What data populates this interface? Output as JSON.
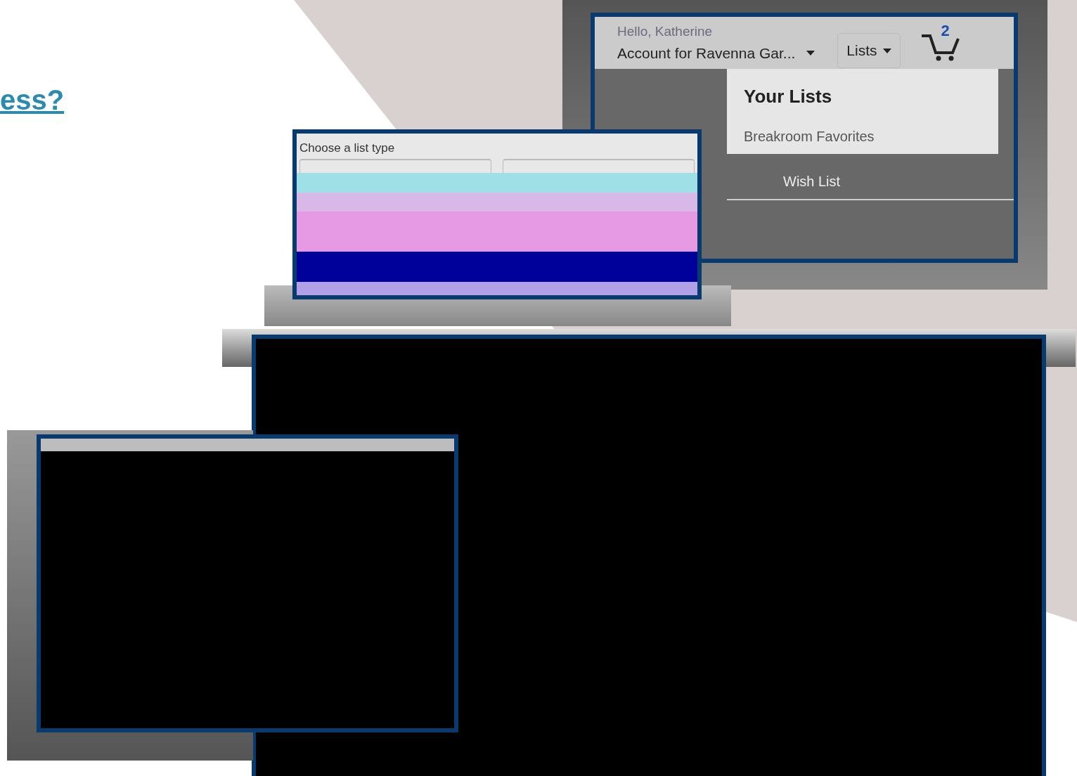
{
  "heading_link": "ess?",
  "account_header": {
    "greeting": "Hello, Katherine",
    "account": "Account for Ravenna Gar...",
    "lists_button": "Lists",
    "cart_count": "2"
  },
  "lists_menu": {
    "title": "Your Lists",
    "items": [
      "Breakroom Favorites",
      "Wish List"
    ]
  },
  "list_type_dialog": {
    "title": "Choose a list type"
  }
}
